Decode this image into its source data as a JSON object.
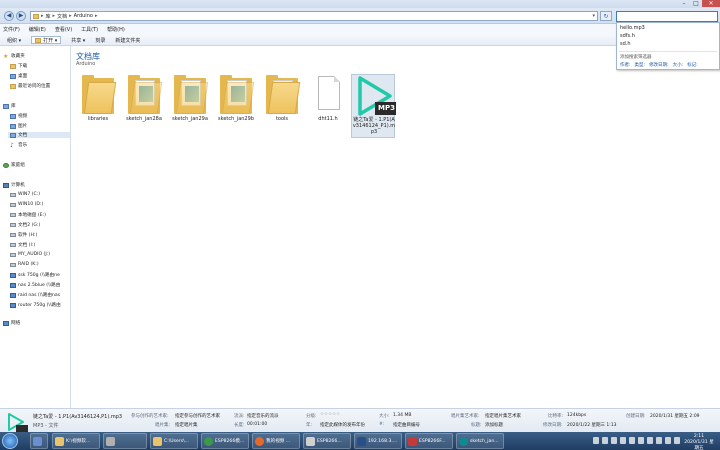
{
  "address": {
    "crumbs": [
      "库",
      "文档",
      "Arduino"
    ]
  },
  "search_suggestions": [
    "hello.mp3",
    "sdfs.h",
    "sd.h"
  ],
  "search_hint": "添加搜索筛选器",
  "search_filters": [
    "作者:",
    "类型:",
    "修改日期:",
    "大小:",
    "标记:"
  ],
  "menu": [
    "文件(F)",
    "编辑(E)",
    "查看(V)",
    "工具(T)",
    "帮助(H)"
  ],
  "toolbar": {
    "organize": "组织 ▾",
    "open": "打开 ▾",
    "share": "共享 ▾",
    "burn": "刻录",
    "new_folder": "新建文件夹"
  },
  "sidebar": {
    "favorites": "收藏夹",
    "fav_items": [
      "下载",
      "桌面",
      "最近访问的位置"
    ],
    "libraries": "库",
    "lib_items": [
      "视频",
      "图片",
      "文档",
      "音乐"
    ],
    "homegroup": "家庭组",
    "computer": "计算机",
    "drives": [
      "WIN7 (C:)",
      "WIN10 (D:)",
      "本地磁盘 (E:)",
      "文档2 (G:)",
      "软件 (H:)",
      "文档 (I:)",
      "MY_AUDIO (J:)",
      "RAID (K:)",
      "ssk 750g (\\\\路由ne",
      "nas 2.5blue (\\\\路由",
      "raid nas (\\\\路由nas",
      "router 750g (\\\\路由"
    ],
    "network": "网络"
  },
  "library": {
    "title": "文档库",
    "subtitle": "Arduino"
  },
  "files": [
    {
      "name": "libraries",
      "kind": "folder"
    },
    {
      "name": "sketch_jan28a",
      "kind": "folder-doc"
    },
    {
      "name": "sketch_jan29a",
      "kind": "folder-doc"
    },
    {
      "name": "sketch_jan29b",
      "kind": "folder-doc"
    },
    {
      "name": "tools",
      "kind": "folder"
    },
    {
      "name": "dht11.h",
      "kind": "file"
    },
    {
      "name": "链之Ta爱 - 1.P1(Av3146124_P1).mp3",
      "kind": "mp3"
    }
  ],
  "mp3_badge": "MP3",
  "details": {
    "name": "链之Ta爱 - 1.P1(Av3146124,P1).mp3",
    "type": "MP3 - 文件",
    "fields": [
      {
        "k": "参与创作的艺术家:",
        "v": "指定参与创作的艺术家"
      },
      {
        "k": "唱片集:",
        "v": "指定唱片集"
      },
      {
        "k": "流派:",
        "v": "指定音乐的流派"
      },
      {
        "k": "长度:",
        "v": "00:01:00"
      },
      {
        "k": "分级:",
        "v": "☆☆☆☆☆"
      },
      {
        "k": "年:",
        "v": "指定此媒体的发布年份"
      },
      {
        "k": "大小:",
        "v": "1.34 MB"
      },
      {
        "k": "#:",
        "v": "指定曲目编号"
      },
      {
        "k": "唱片集艺术家:",
        "v": "指定唱片集艺术家"
      },
      {
        "k": "标题:",
        "v": "添加标题"
      },
      {
        "k": "比特率:",
        "v": "124kbps"
      },
      {
        "k": "修改日期:",
        "v": "2020/1/22 星期三 1:13"
      },
      {
        "k": "创建日期:",
        "v": "2020/1/31 星期五 2:09"
      }
    ]
  },
  "taskbar": [
    {
      "label": "",
      "color": "#6a8fd0"
    },
    {
      "label": "K:\\视频软...",
      "color": "#e9c46a"
    },
    {
      "label": "",
      "color": "#b0b0b0"
    },
    {
      "label": "C:\\Users\\...",
      "color": "#e9c46a"
    },
    {
      "label": "ESP8266模...",
      "color": "#3a9a4a"
    },
    {
      "label": "我的视频 ...",
      "color": "#e36a2a"
    },
    {
      "label": "ESP8266...",
      "color": "#d0d0d0"
    },
    {
      "label": "192.168.3....",
      "color": "#2a4e8a"
    },
    {
      "label": "ESP8266F...",
      "color": "#c23a3a"
    },
    {
      "label": "sketch_jan...",
      "color": "#0f8a8f"
    }
  ],
  "clock": {
    "time": "2:11",
    "date": "2020/1/31 星期五"
  },
  "colors": {
    "accent": "#1e5aa8",
    "mp3_play": "#20c9a8"
  }
}
